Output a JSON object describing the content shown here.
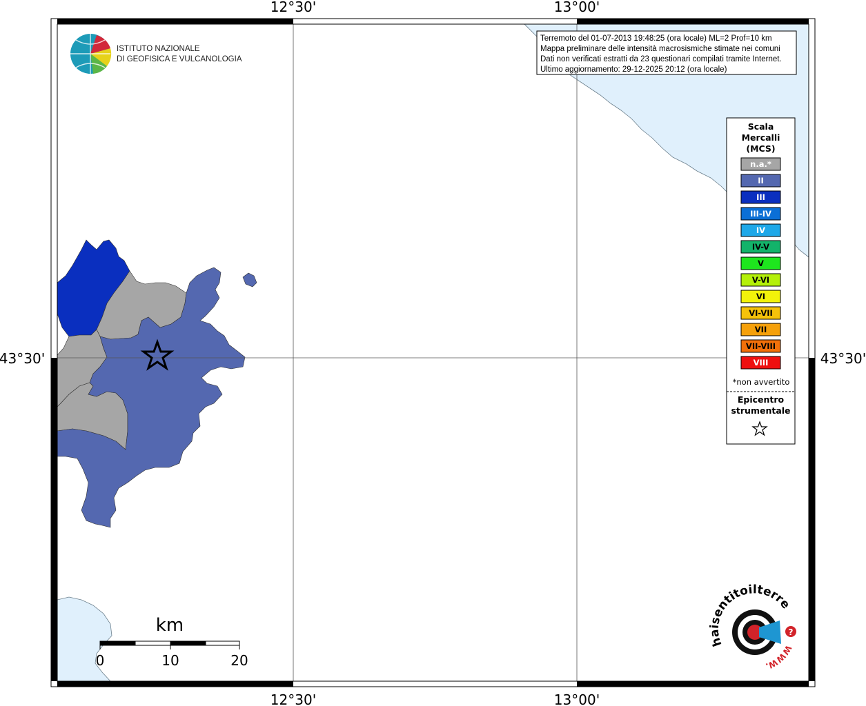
{
  "grid": {
    "top_labels": [
      "12°30'",
      "13°00'"
    ],
    "bottom_labels": [
      "12°30'",
      "13°00'"
    ],
    "left_label": "43°30'",
    "right_label": "43°30'"
  },
  "logo": {
    "line1": "ISTITUTO NAZIONALE",
    "line2": "DI GEOFISICA E VULCANOLOGIA"
  },
  "info_box": {
    "lines": [
      "Terremoto del 01-07-2013 19:48:25 (ora locale) ML=2 Prof=10 km",
      "Mappa preliminare delle intensità macrosismiche stimate nei comuni",
      "Dati non verificati estratti da 23 questionari compilati tramite Internet.",
      "Ultimo aggiornamento: 29-12-2025 20:12 (ora locale)"
    ]
  },
  "legend": {
    "title_lines": [
      "Scala",
      "Mercalli",
      "(MCS)"
    ],
    "items": [
      {
        "label": "n.a.*",
        "color": "#a6a6a6",
        "text_color": "#ffffff"
      },
      {
        "label": "II",
        "color": "#5468b0",
        "text_color": "#ffffff"
      },
      {
        "label": "III",
        "color": "#0a2fbf",
        "text_color": "#ffffff"
      },
      {
        "label": "III-IV",
        "color": "#0b6fd6",
        "text_color": "#ffffff"
      },
      {
        "label": "IV",
        "color": "#1ea8e8",
        "text_color": "#ffffff"
      },
      {
        "label": "IV-V",
        "color": "#13b36a",
        "text_color": "#000000"
      },
      {
        "label": "V",
        "color": "#1ee61e",
        "text_color": "#000000"
      },
      {
        "label": "V-VI",
        "color": "#b4f00a",
        "text_color": "#000000"
      },
      {
        "label": "VI",
        "color": "#f2f20a",
        "text_color": "#000000"
      },
      {
        "label": "VI-VII",
        "color": "#f5c20a",
        "text_color": "#000000"
      },
      {
        "label": "VII",
        "color": "#f5a00a",
        "text_color": "#000000"
      },
      {
        "label": "VII-VIII",
        "color": "#f2700a",
        "text_color": "#000000"
      },
      {
        "label": "VIII",
        "color": "#ee1010",
        "text_color": "#ffffff"
      }
    ],
    "note": "*non avvertito",
    "epicenter_lines": [
      "Epicentro",
      "strumentale"
    ]
  },
  "scale_bar": {
    "unit": "km",
    "ticks": [
      "0",
      "10",
      "20"
    ]
  },
  "watermark": {
    "text_top": "haisentitoilterremoto.it",
    "text_bottom": "WWW."
  },
  "colors": {
    "sea": "#e0f0fc",
    "intensity_II": "#5468b0",
    "intensity_III": "#0a2fbf",
    "not_felt": "#a6a6a6"
  }
}
